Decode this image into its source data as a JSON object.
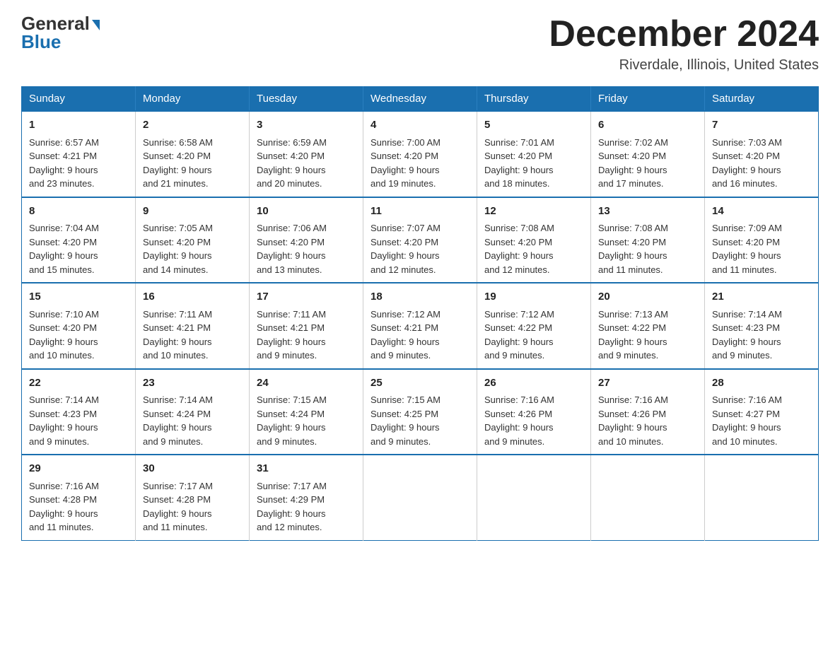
{
  "logo": {
    "general": "General",
    "triangle": "▲",
    "blue": "Blue"
  },
  "header": {
    "month": "December 2024",
    "location": "Riverdale, Illinois, United States"
  },
  "days_of_week": [
    "Sunday",
    "Monday",
    "Tuesday",
    "Wednesday",
    "Thursday",
    "Friday",
    "Saturday"
  ],
  "weeks": [
    [
      {
        "day": "1",
        "sunrise": "6:57 AM",
        "sunset": "4:21 PM",
        "daylight": "9 hours and 23 minutes."
      },
      {
        "day": "2",
        "sunrise": "6:58 AM",
        "sunset": "4:20 PM",
        "daylight": "9 hours and 21 minutes."
      },
      {
        "day": "3",
        "sunrise": "6:59 AM",
        "sunset": "4:20 PM",
        "daylight": "9 hours and 20 minutes."
      },
      {
        "day": "4",
        "sunrise": "7:00 AM",
        "sunset": "4:20 PM",
        "daylight": "9 hours and 19 minutes."
      },
      {
        "day": "5",
        "sunrise": "7:01 AM",
        "sunset": "4:20 PM",
        "daylight": "9 hours and 18 minutes."
      },
      {
        "day": "6",
        "sunrise": "7:02 AM",
        "sunset": "4:20 PM",
        "daylight": "9 hours and 17 minutes."
      },
      {
        "day": "7",
        "sunrise": "7:03 AM",
        "sunset": "4:20 PM",
        "daylight": "9 hours and 16 minutes."
      }
    ],
    [
      {
        "day": "8",
        "sunrise": "7:04 AM",
        "sunset": "4:20 PM",
        "daylight": "9 hours and 15 minutes."
      },
      {
        "day": "9",
        "sunrise": "7:05 AM",
        "sunset": "4:20 PM",
        "daylight": "9 hours and 14 minutes."
      },
      {
        "day": "10",
        "sunrise": "7:06 AM",
        "sunset": "4:20 PM",
        "daylight": "9 hours and 13 minutes."
      },
      {
        "day": "11",
        "sunrise": "7:07 AM",
        "sunset": "4:20 PM",
        "daylight": "9 hours and 12 minutes."
      },
      {
        "day": "12",
        "sunrise": "7:08 AM",
        "sunset": "4:20 PM",
        "daylight": "9 hours and 12 minutes."
      },
      {
        "day": "13",
        "sunrise": "7:08 AM",
        "sunset": "4:20 PM",
        "daylight": "9 hours and 11 minutes."
      },
      {
        "day": "14",
        "sunrise": "7:09 AM",
        "sunset": "4:20 PM",
        "daylight": "9 hours and 11 minutes."
      }
    ],
    [
      {
        "day": "15",
        "sunrise": "7:10 AM",
        "sunset": "4:20 PM",
        "daylight": "9 hours and 10 minutes."
      },
      {
        "day": "16",
        "sunrise": "7:11 AM",
        "sunset": "4:21 PM",
        "daylight": "9 hours and 10 minutes."
      },
      {
        "day": "17",
        "sunrise": "7:11 AM",
        "sunset": "4:21 PM",
        "daylight": "9 hours and 9 minutes."
      },
      {
        "day": "18",
        "sunrise": "7:12 AM",
        "sunset": "4:21 PM",
        "daylight": "9 hours and 9 minutes."
      },
      {
        "day": "19",
        "sunrise": "7:12 AM",
        "sunset": "4:22 PM",
        "daylight": "9 hours and 9 minutes."
      },
      {
        "day": "20",
        "sunrise": "7:13 AM",
        "sunset": "4:22 PM",
        "daylight": "9 hours and 9 minutes."
      },
      {
        "day": "21",
        "sunrise": "7:14 AM",
        "sunset": "4:23 PM",
        "daylight": "9 hours and 9 minutes."
      }
    ],
    [
      {
        "day": "22",
        "sunrise": "7:14 AM",
        "sunset": "4:23 PM",
        "daylight": "9 hours and 9 minutes."
      },
      {
        "day": "23",
        "sunrise": "7:14 AM",
        "sunset": "4:24 PM",
        "daylight": "9 hours and 9 minutes."
      },
      {
        "day": "24",
        "sunrise": "7:15 AM",
        "sunset": "4:24 PM",
        "daylight": "9 hours and 9 minutes."
      },
      {
        "day": "25",
        "sunrise": "7:15 AM",
        "sunset": "4:25 PM",
        "daylight": "9 hours and 9 minutes."
      },
      {
        "day": "26",
        "sunrise": "7:16 AM",
        "sunset": "4:26 PM",
        "daylight": "9 hours and 9 minutes."
      },
      {
        "day": "27",
        "sunrise": "7:16 AM",
        "sunset": "4:26 PM",
        "daylight": "9 hours and 10 minutes."
      },
      {
        "day": "28",
        "sunrise": "7:16 AM",
        "sunset": "4:27 PM",
        "daylight": "9 hours and 10 minutes."
      }
    ],
    [
      {
        "day": "29",
        "sunrise": "7:16 AM",
        "sunset": "4:28 PM",
        "daylight": "9 hours and 11 minutes."
      },
      {
        "day": "30",
        "sunrise": "7:17 AM",
        "sunset": "4:28 PM",
        "daylight": "9 hours and 11 minutes."
      },
      {
        "day": "31",
        "sunrise": "7:17 AM",
        "sunset": "4:29 PM",
        "daylight": "9 hours and 12 minutes."
      },
      null,
      null,
      null,
      null
    ]
  ],
  "labels": {
    "sunrise": "Sunrise:",
    "sunset": "Sunset:",
    "daylight": "Daylight:"
  }
}
